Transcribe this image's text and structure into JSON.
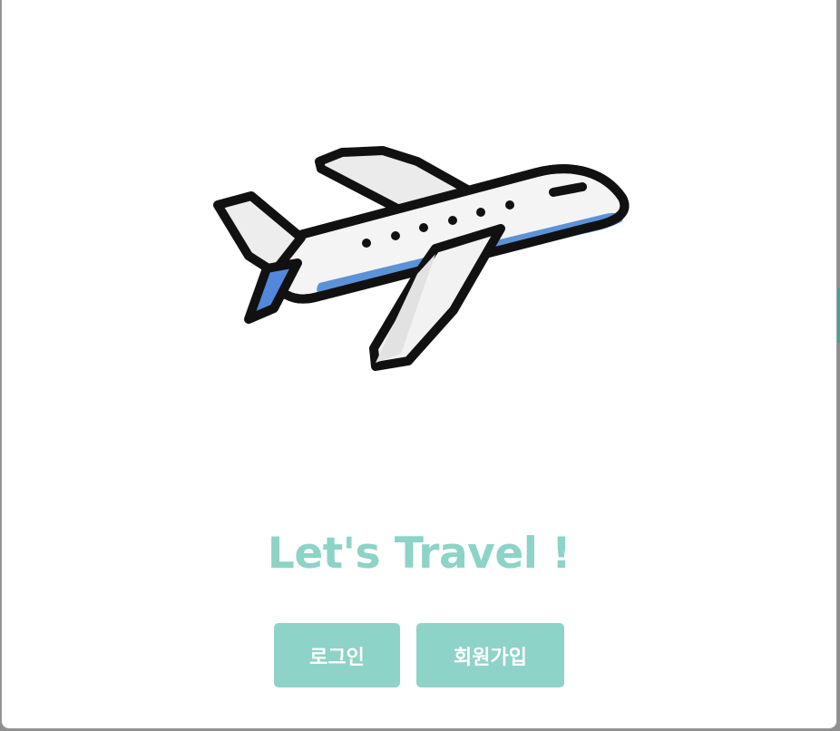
{
  "theme": {
    "accent": "#8dd3c7",
    "backdrop": "#8f8f8f",
    "modal_background": "#ffffff"
  },
  "modal": {
    "illustration_icon": "airplane-icon",
    "title": "Let's Travel !",
    "actions": {
      "login_label": "로그인",
      "signup_label": "회원가입"
    }
  }
}
